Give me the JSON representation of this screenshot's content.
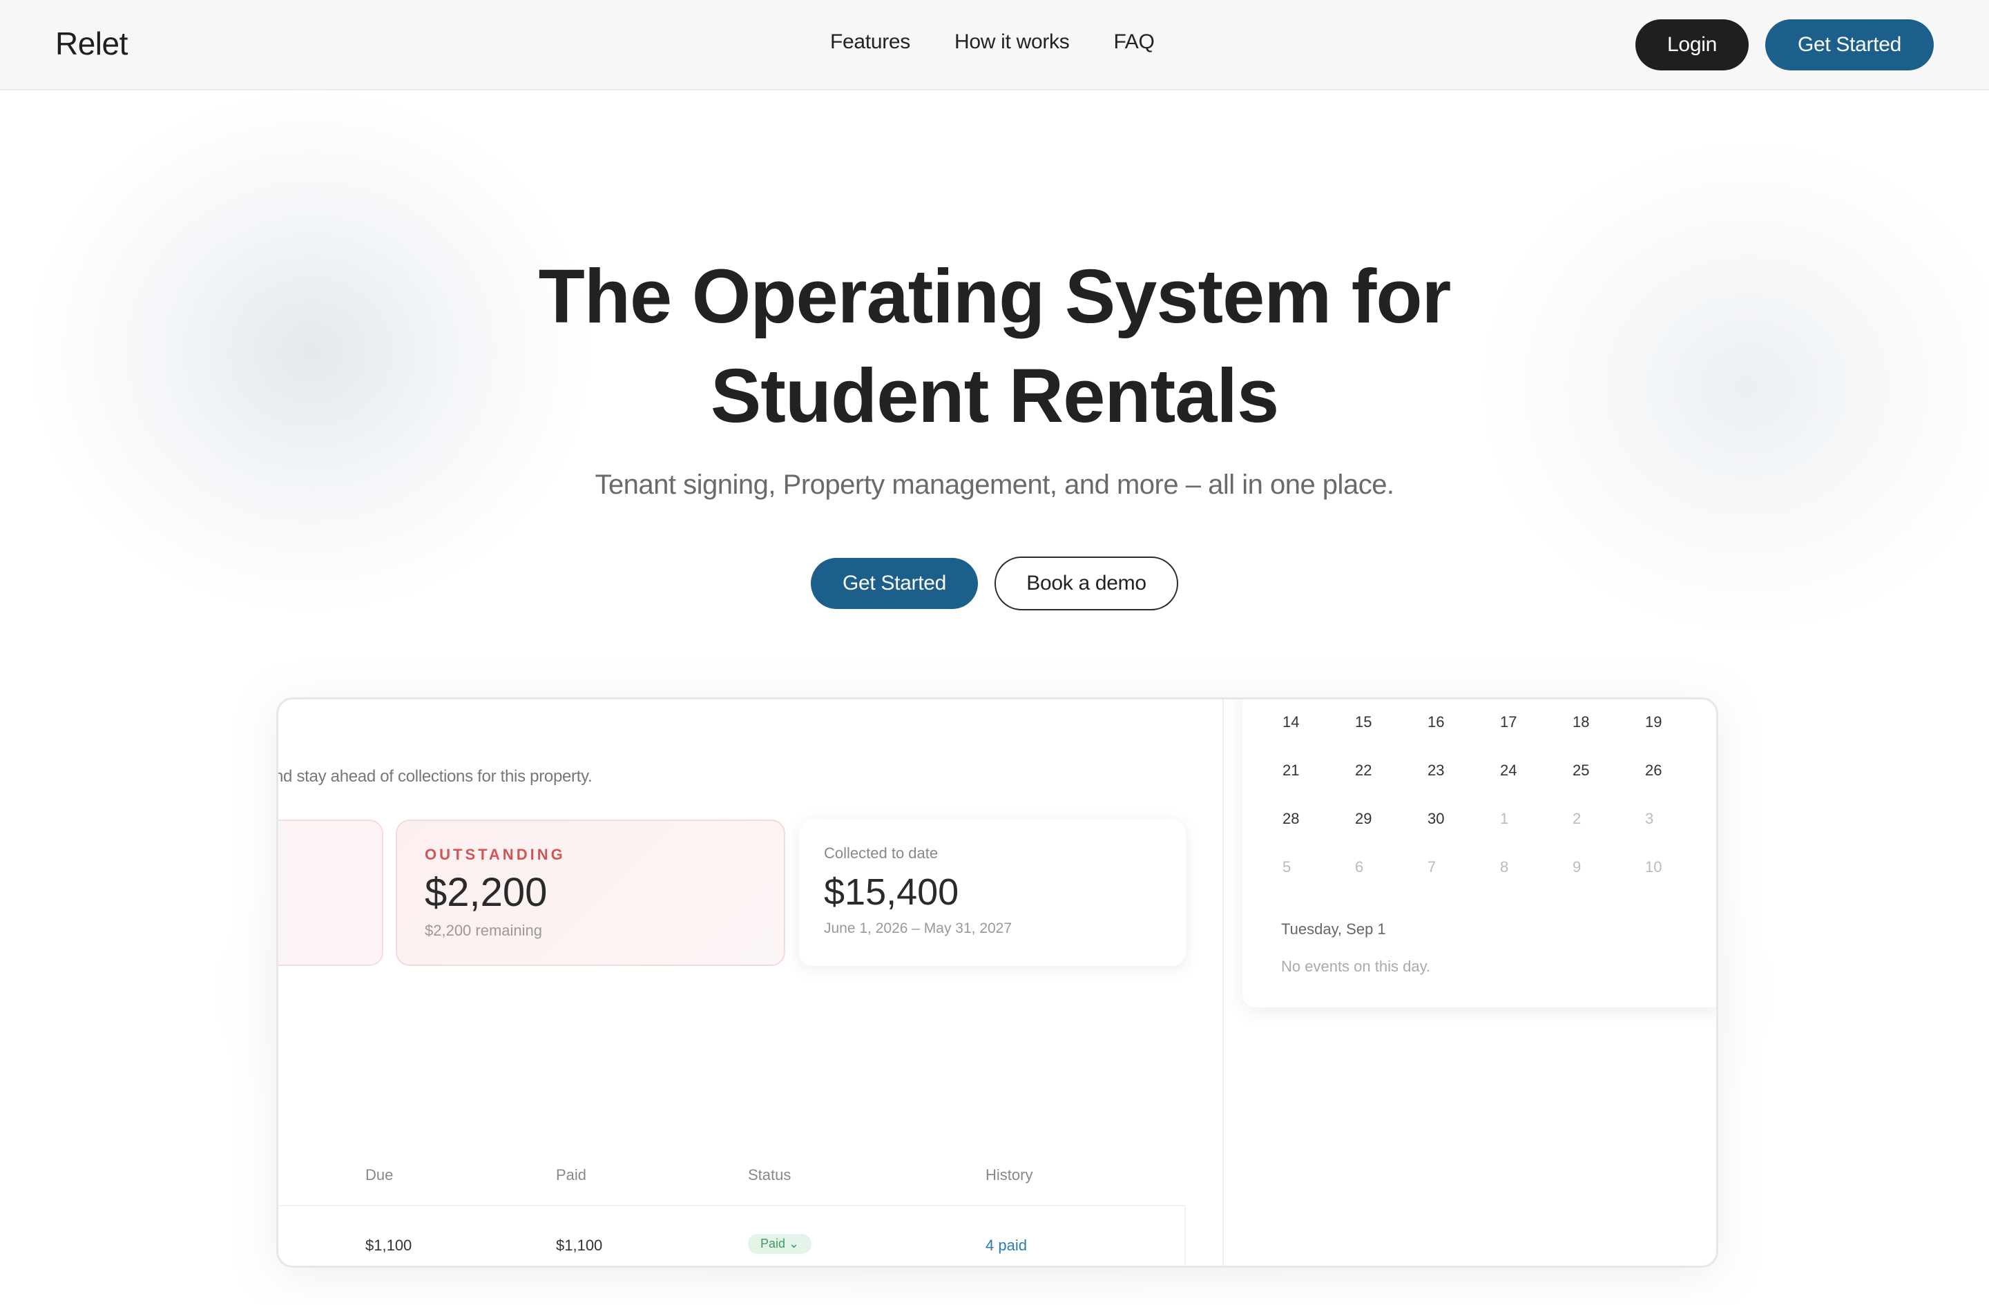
{
  "nav": {
    "logo": "Relet",
    "links": [
      "Features",
      "How it works",
      "FAQ"
    ],
    "login_label": "Login",
    "get_started_label": "Get Started"
  },
  "hero": {
    "title_line1": "The Operating System for",
    "title_line2": "Student Rentals",
    "subtitle": "Tenant signing, Property management, and more – all in one place.",
    "get_started_label": "Get Started",
    "demo_label": "Book a demo"
  },
  "preview": {
    "intro_text": "nd stay ahead of collections for this property.",
    "outstanding": {
      "label": "OUTSTANDING",
      "value": "$2,200",
      "sub": "$2,200 remaining"
    },
    "collected": {
      "label": "Collected to date",
      "value": "$15,400",
      "sub": "June 1, 2026 – May 31, 2027"
    },
    "table": {
      "headers": [
        "Due",
        "Paid",
        "Status",
        "History"
      ],
      "row": {
        "due": "$1,100",
        "paid": "$1,100",
        "status": "Paid ⌄",
        "history": "4 paid"
      }
    },
    "calendar": {
      "weeks": [
        [
          "14",
          "15",
          "16",
          "17",
          "18",
          "19"
        ],
        [
          "21",
          "22",
          "23",
          "24",
          "25",
          "26"
        ],
        [
          "28",
          "29",
          "30",
          "1",
          "2",
          "3"
        ],
        [
          "5",
          "6",
          "7",
          "8",
          "9",
          "10"
        ]
      ],
      "selected_date": "Tuesday, Sep 1",
      "empty_text": "No events on this day."
    }
  },
  "colors": {
    "brand": "#1b5f8a",
    "dark": "#1f1f1f",
    "outstanding_label": "#d25555",
    "paid_badge": "#3c9a5f"
  }
}
